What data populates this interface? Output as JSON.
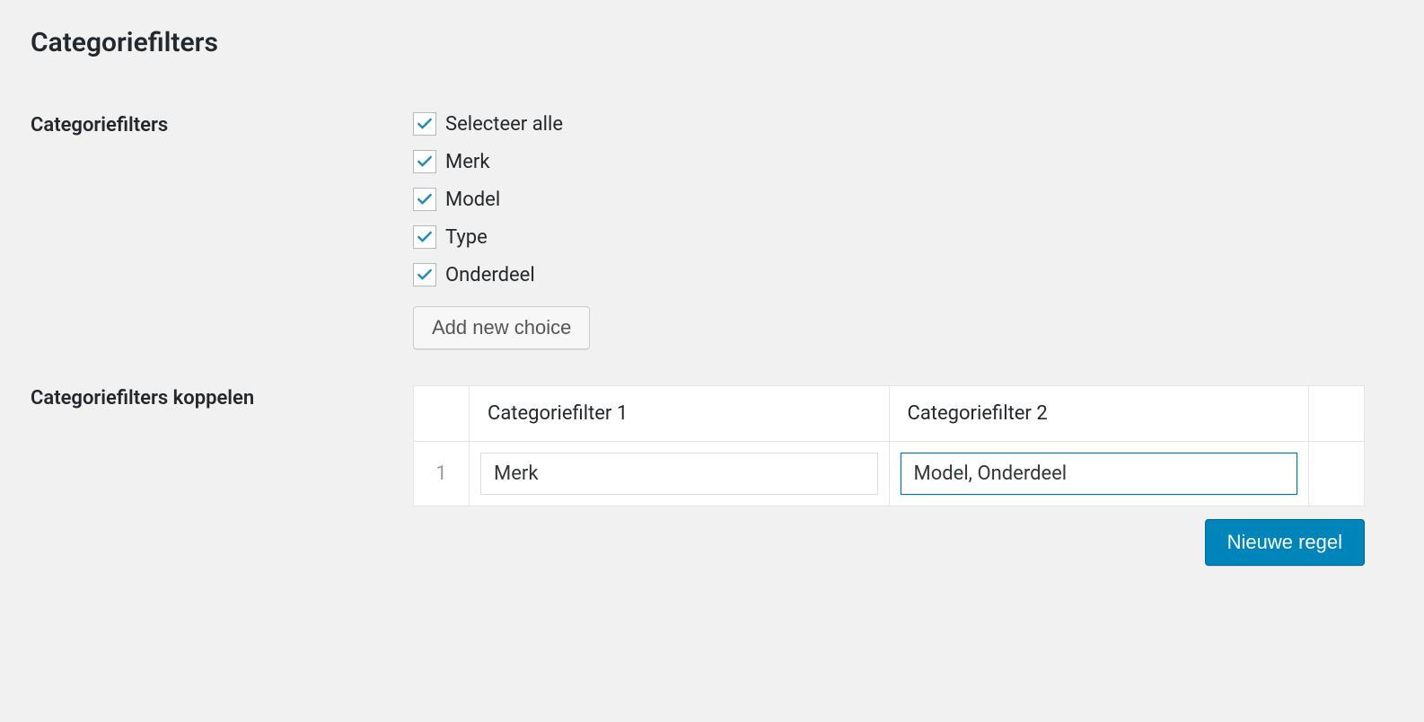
{
  "title": "Categoriefilters",
  "labels": {
    "filters": "Categoriefilters",
    "link": "Categoriefilters koppelen"
  },
  "checkboxes": [
    {
      "label": "Selecteer alle",
      "checked": true
    },
    {
      "label": "Merk",
      "checked": true
    },
    {
      "label": "Model",
      "checked": true
    },
    {
      "label": "Type",
      "checked": true
    },
    {
      "label": "Onderdeel",
      "checked": true
    }
  ],
  "add_choice": "Add new choice",
  "table": {
    "headers": {
      "col1": "Categoriefilter 1",
      "col2": "Categoriefilter 2"
    },
    "rows": [
      {
        "num": "1",
        "col1": "Merk",
        "col2": "Model, Onderdeel"
      }
    ]
  },
  "new_rule": "Nieuwe regel"
}
